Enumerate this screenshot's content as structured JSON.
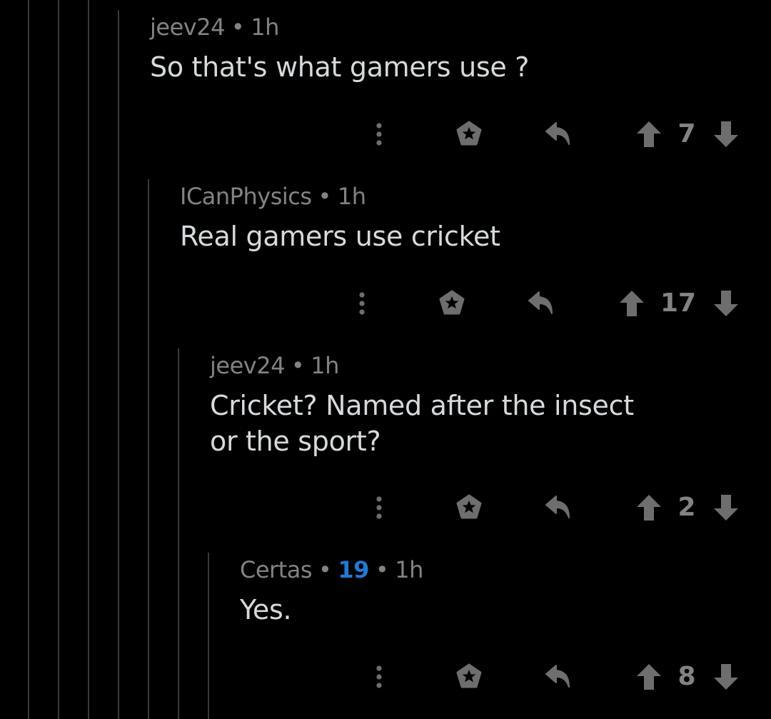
{
  "comments": [
    {
      "author": "jeev24",
      "time": "1h",
      "body": [
        "So that's what gamers use ?"
      ],
      "votes": "7"
    },
    {
      "author": "ICanPhysics",
      "time": "1h",
      "body": [
        "Real gamers use cricket"
      ],
      "votes": "17"
    },
    {
      "author": "jeev24",
      "time": "1h",
      "body": [
        "Cricket? Named after the insect",
        "or the sport?"
      ],
      "votes": "2"
    },
    {
      "author": "Certas",
      "flair_score": "19",
      "time": "1h",
      "body": [
        "Yes."
      ],
      "votes": "8"
    }
  ],
  "separator": "•",
  "icons": {
    "more": "more-options-icon",
    "award": "award-icon",
    "reply": "reply-icon",
    "upvote": "upvote-arrow-icon",
    "downvote": "downvote-arrow-icon"
  },
  "colors": {
    "background": "#000000",
    "meta_text": "#818384",
    "body_text": "#d7dadc",
    "flair_score": "#1f7ad6",
    "icon": "#6e6e6e",
    "thread_line": "#3a3a3a"
  }
}
